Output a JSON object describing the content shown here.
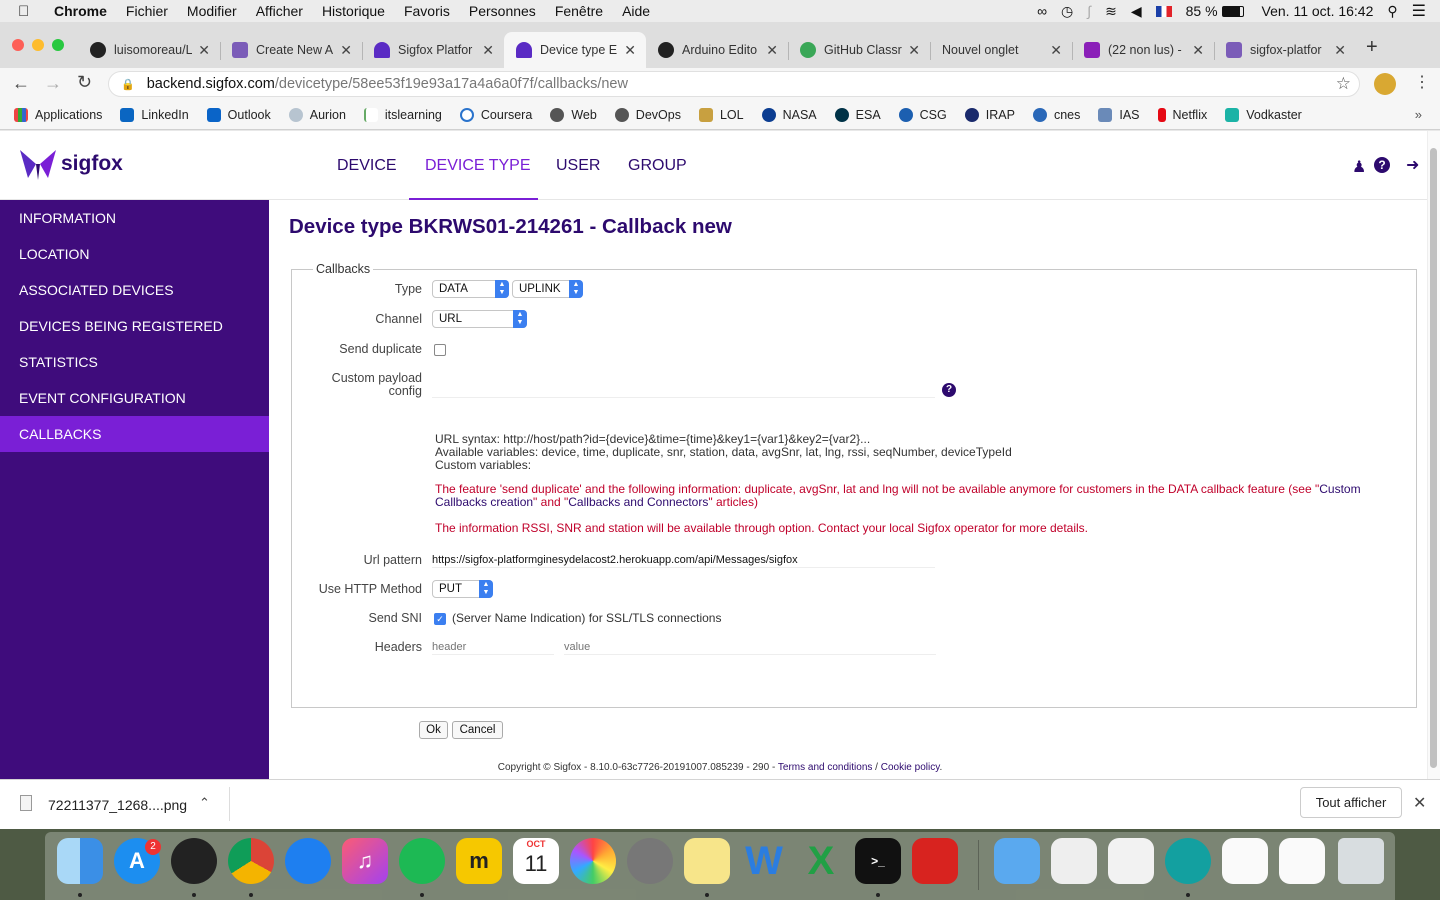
{
  "os_menubar": {
    "app": "Chrome",
    "items": [
      "Fichier",
      "Modifier",
      "Afficher",
      "Historique",
      "Favoris",
      "Personnes",
      "Fenêtre",
      "Aide"
    ],
    "battery": "85 %",
    "clock": "Ven. 11 oct.  16:42"
  },
  "tabs": [
    {
      "title": "luisomoreau/L",
      "icon": "github-icon"
    },
    {
      "title": "Create New A",
      "icon": "heroku-icon"
    },
    {
      "title": "Sigfox Platfor",
      "icon": "sigfox-icon"
    },
    {
      "title": "Device type E",
      "icon": "sigfox-icon",
      "active": true
    },
    {
      "title": "Arduino Edito",
      "icon": "arduino-icon"
    },
    {
      "title": "GitHub Classr",
      "icon": "github-classroom-icon"
    },
    {
      "title": "Nouvel onglet",
      "icon": ""
    },
    {
      "title": "(22 non lus) -",
      "icon": "mail-icon"
    },
    {
      "title": "sigfox-platfor",
      "icon": "heroku-icon"
    }
  ],
  "address": {
    "host": "backend.sigfox.com",
    "path": "/devicetype/58ee53f19e93a17a4a6a0f7f/callbacks/new"
  },
  "bookmarks": [
    "Applications",
    "LinkedIn",
    "Outlook",
    "Aurion",
    "itslearning",
    "Coursera",
    "Web",
    "DevOps",
    "LOL",
    "NASA",
    "ESA",
    "CSG",
    "IRAP",
    "cnes",
    "IAS",
    "Netflix",
    "Vodkaster"
  ],
  "brand": "sigfox",
  "topnav": [
    "DEVICE",
    "DEVICE TYPE",
    "USER",
    "GROUP"
  ],
  "sidebar": [
    "INFORMATION",
    "LOCATION",
    "ASSOCIATED DEVICES",
    "DEVICES BEING REGISTERED",
    "STATISTICS",
    "EVENT CONFIGURATION",
    "CALLBACKS"
  ],
  "page_title": "Device type BKRWS01-214261 - Callback new",
  "form": {
    "legend": "Callbacks",
    "type_label": "Type",
    "type_value": "DATA",
    "direction_value": "UPLINK",
    "channel_label": "Channel",
    "channel_value": "URL",
    "send_duplicate_label": "Send duplicate",
    "send_duplicate_checked": false,
    "custom_payload_label_1": "Custom payload",
    "custom_payload_label_2": "config",
    "custom_payload_value": "",
    "url_syntax": "URL syntax: http://host/path?id={device}&time={time}&key1={var1}&key2={var2}...",
    "available_vars": "Available variables: device, time, duplicate, snr, station, data, avgSnr, lat, lng, rssi, seqNumber, deviceTypeId",
    "custom_vars": "Custom variables:",
    "warning1_a": "The feature 'send duplicate' and the following information: duplicate, avgSnr, lat and lng will not be available anymore for customers in the DATA callback feature (see \"",
    "warning1_link1": "Custom Callbacks creation",
    "warning1_b": "\" and \"",
    "warning1_link2": "Callbacks and Connectors",
    "warning1_c": "\" articles)",
    "warning2": "The information RSSI, SNR and station will be available through option. Contact your local Sigfox operator for more details.",
    "url_pattern_label": "Url pattern",
    "url_pattern_value": "https://sigfox-platformginesydelacost2.herokuapp.com/api/Messages/sigfox",
    "http_method_label": "Use HTTP Method",
    "http_method_value": "PUT",
    "send_sni_label": "Send SNI",
    "send_sni_checked": true,
    "send_sni_text": "(Server Name Indication) for SSL/TLS connections",
    "headers_label": "Headers",
    "header_placeholder": "header",
    "value_placeholder": "value",
    "ok": "Ok",
    "cancel": "Cancel"
  },
  "copyright": {
    "text": "Copyright © Sigfox - 8.10.0-63c7726-20191007.085239 - 290 - ",
    "terms": "Terms and conditions",
    "sep": " / ",
    "cookie": "Cookie policy",
    "end": "."
  },
  "download": {
    "filename": "72211377_1268....png",
    "show_all": "Tout afficher"
  },
  "dock": {
    "badge": "2",
    "calendar_month": "OCT",
    "calendar_day": "11"
  },
  "colors": {
    "sigfox_dark": "#2d0a6e",
    "sigfox_sidebar": "#3f0c7c",
    "sigfox_accent": "#7a1fd6",
    "warning": "#c0002a"
  }
}
